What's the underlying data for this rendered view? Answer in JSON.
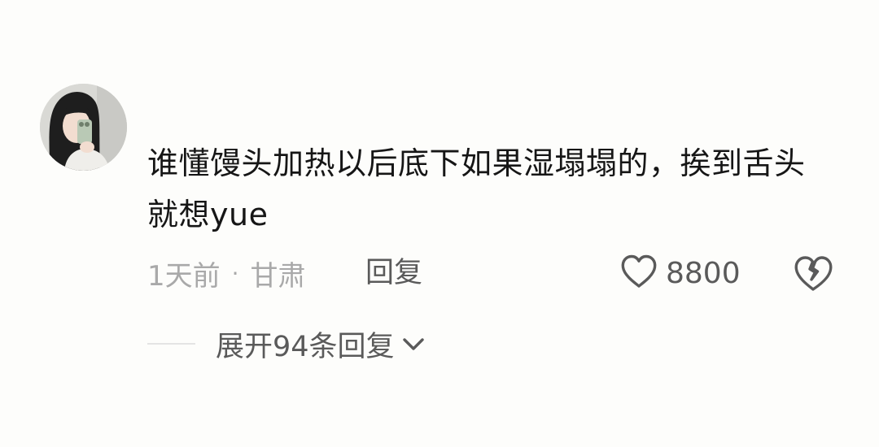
{
  "comment": {
    "text": "谁懂馒头加热以后底下如果湿塌塌的，挨到舌头就想yue",
    "time": "1天前",
    "separator": "·",
    "location": "甘肃",
    "reply_label": "回复",
    "like_count": "8800",
    "expand_replies_label": "展开94条回复"
  },
  "icons": {
    "like": "heart-outline-icon",
    "dislike": "broken-heart-icon",
    "expand": "chevron-down-icon"
  },
  "colors": {
    "background": "#fdfdfb",
    "text": "#161616",
    "meta": "#a9a9a9",
    "action": "#5a5a5a"
  }
}
